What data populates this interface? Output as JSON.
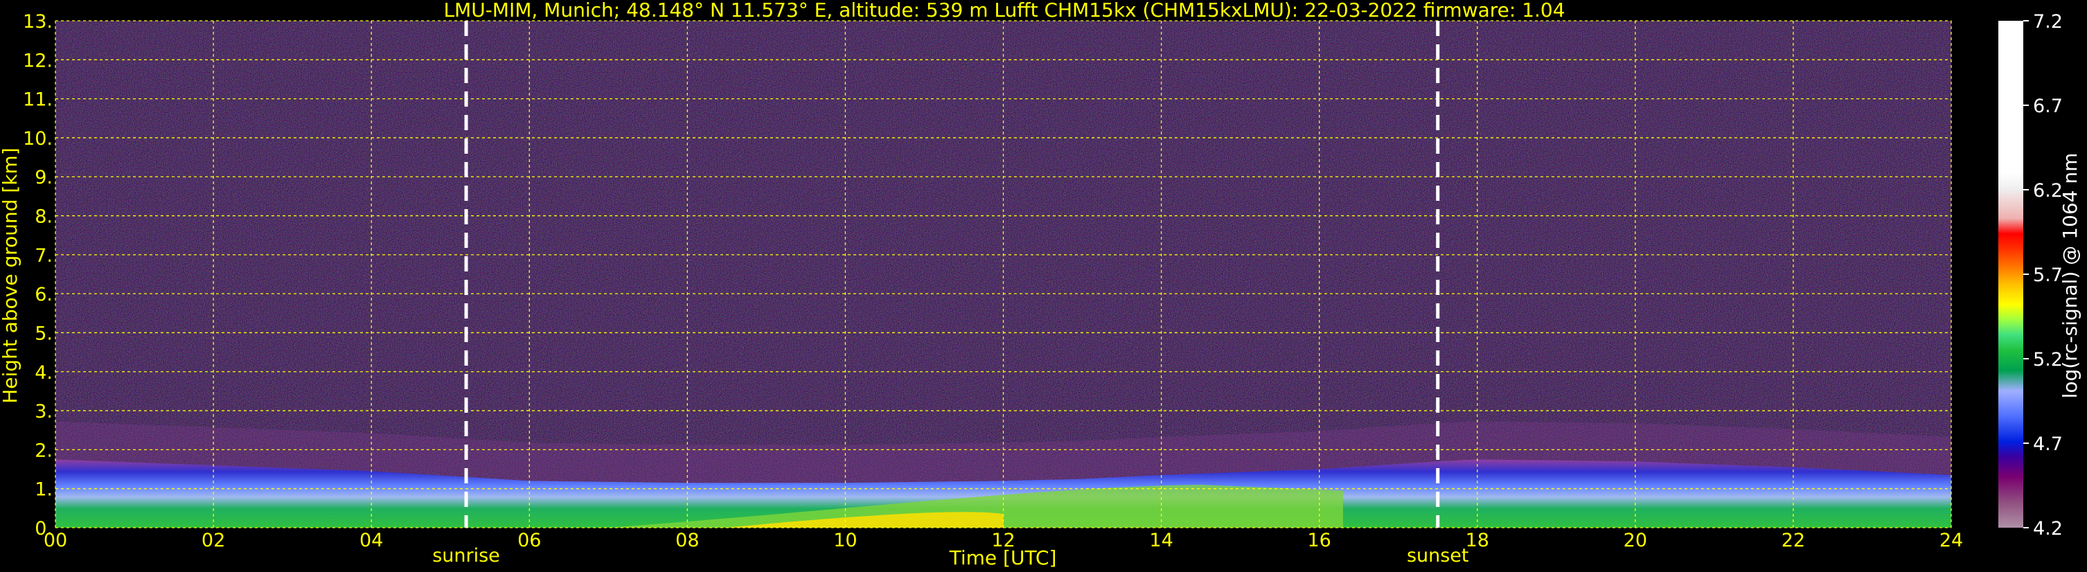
{
  "chart_data": {
    "type": "heatmap",
    "title": "LMU-MIM, Munich; 48.148° N 11.573° E, altitude: 539 m    Lufft CHM15kx (CHM15kxLMU): 22-03-2022    firmware: 1.04",
    "xlabel": "Time [UTC]",
    "ylabel": "Height above ground [km]",
    "xlim": [
      0,
      24
    ],
    "ylim": [
      0,
      13
    ],
    "x_ticks": [
      "00",
      "02",
      "04",
      "06",
      "08",
      "10",
      "12",
      "14",
      "16",
      "18",
      "20",
      "22",
      "24"
    ],
    "y_ticks": [
      "0.",
      "1.",
      "2.",
      "3.",
      "4.",
      "5.",
      "6.",
      "7.",
      "8.",
      "9.",
      "10.",
      "11.",
      "12.",
      "13."
    ],
    "grid": true,
    "grid_color": "#ffff00",
    "colorbar": {
      "label": "log(rc-signal) @ 1064 nm",
      "range": [
        4.2,
        7.2
      ],
      "ticks": [
        "4.2",
        "4.7",
        "5.2",
        "5.7",
        "6.2",
        "6.7",
        "7.2"
      ],
      "placement": "right"
    },
    "annotations": [
      {
        "label": "sunrise",
        "x": 5.2
      },
      {
        "label": "sunset",
        "x": 17.5
      }
    ],
    "layers": [
      {
        "name": "boundary-layer-top",
        "x": [
          0,
          2,
          4,
          5.2,
          6,
          8,
          10,
          12,
          13,
          14,
          16,
          17.5,
          18,
          20,
          22,
          24
        ],
        "y": [
          1.75,
          1.6,
          1.45,
          1.3,
          1.2,
          1.15,
          1.15,
          1.2,
          1.25,
          1.35,
          1.5,
          1.7,
          1.75,
          1.7,
          1.55,
          1.35
        ]
      }
    ]
  }
}
